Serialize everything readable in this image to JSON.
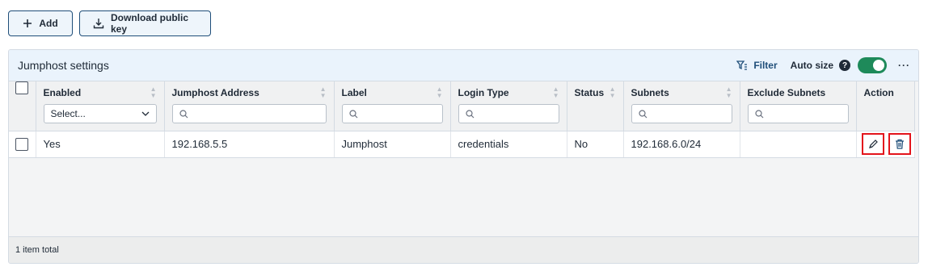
{
  "toolbar": {
    "add_label": "Add",
    "download_label": "Download public key"
  },
  "panel": {
    "title": "Jumphost settings",
    "filter_label": "Filter",
    "autosize_label": "Auto size",
    "help_glyph": "?",
    "autosize_on": true,
    "more_glyph": "···"
  },
  "columns": [
    {
      "label": "Enabled",
      "filter": "select",
      "placeholder": "Select..."
    },
    {
      "label": "Jumphost Address",
      "filter": "search"
    },
    {
      "label": "Label",
      "filter": "search"
    },
    {
      "label": "Login Type",
      "filter": "search"
    },
    {
      "label": "Status",
      "filter": "none"
    },
    {
      "label": "Subnets",
      "filter": "search"
    },
    {
      "label": "Exclude Subnets",
      "filter": "search"
    },
    {
      "label": "Action",
      "filter": "none"
    }
  ],
  "rows": [
    {
      "enabled": "Yes",
      "address": "192.168.5.5",
      "label": "Jumphost",
      "login_type": "credentials",
      "status": "No",
      "subnets": "192.168.6.0/24",
      "exclude_subnets": ""
    }
  ],
  "footer": {
    "total": "1 item total"
  },
  "colors": {
    "accent": "#1f4e79",
    "toggle": "#1e8a5a",
    "highlight": "#e3141c",
    "header_bg": "#eaf3fc"
  },
  "icons": [
    "plus-icon",
    "download-icon",
    "filter-icon",
    "help-icon",
    "search-icon",
    "chevron-down-icon",
    "pencil-icon",
    "trash-icon",
    "sort-icon"
  ]
}
